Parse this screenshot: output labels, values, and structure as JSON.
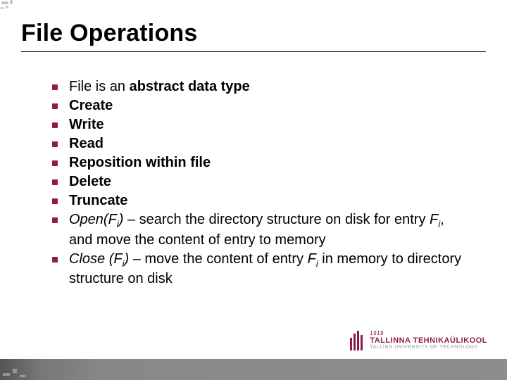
{
  "title": "File Operations",
  "bullets": [
    {
      "pre": "File is an ",
      "bold": "abstract data type",
      "post": ""
    },
    {
      "bold": "Create"
    },
    {
      "bold": "Write"
    },
    {
      "bold": "Read"
    },
    {
      "bold": "Reposition within file"
    },
    {
      "bold": "Delete"
    },
    {
      "bold": "Truncate"
    },
    {
      "italic_fn": "Open(F",
      "italic_sub": "i",
      "italic_fn_close": ")",
      "post": " – search the directory structure on disk for entry ",
      "var": "F",
      "var_sub": "i",
      "post2": ", and move the content of entry to memory"
    },
    {
      "italic_fn": "Close (F",
      "italic_sub": "i",
      "italic_fn_close": ")",
      "post": " – move the content of entry ",
      "var": "F",
      "var_sub": "i",
      "post2": " in memory to directory structure on disk"
    }
  ],
  "logo": {
    "year": "1918",
    "name": "TALLINNA TEHNIKAÜLIKOOL",
    "sub": "TALLINN UNIVERSITY OF TECHNOLOGY"
  },
  "colors": {
    "accent": "#8d1b4f"
  }
}
